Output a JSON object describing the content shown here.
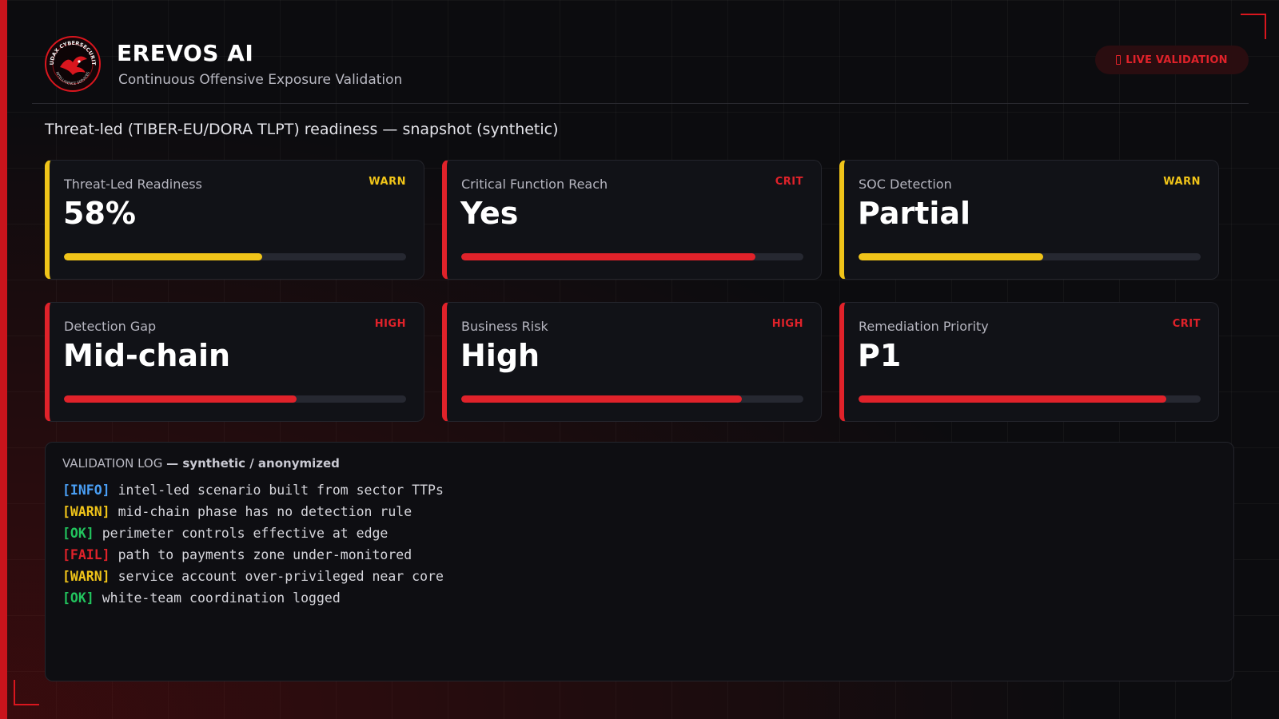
{
  "brand": {
    "title": "EREVOS AI",
    "subtitle": "Continuous Offensive Exposure Validation",
    "logo_ring_text_top": "AUDAX CYBERSECURITY",
    "logo_ring_text_bottom": "INTELLIGENCE SERVICES"
  },
  "badge": {
    "icon": "live-icon",
    "label": "LIVE VALIDATION"
  },
  "snapshot_title": "Threat-led (TIBER-EU/DORA TLPT) readiness — snapshot (synthetic)",
  "colors": {
    "accent": "#e0222a",
    "warn": "#f0c419",
    "info": "#4a9ff5",
    "ok": "#22c55e",
    "background": "#0c0c0f"
  },
  "cards": [
    {
      "label": "Threat-Led Readiness",
      "tag": "WARN",
      "value": "58%",
      "level": 0.58,
      "severity": "warn"
    },
    {
      "label": "Critical Function Reach",
      "tag": "CRIT",
      "value": "Yes",
      "level": 0.86,
      "severity": "crit"
    },
    {
      "label": "SOC Detection",
      "tag": "WARN",
      "value": "Partial",
      "level": 0.54,
      "severity": "warn"
    },
    {
      "label": "Detection Gap",
      "tag": "HIGH",
      "value": "Mid-chain",
      "level": 0.68,
      "severity": "high"
    },
    {
      "label": "Business Risk",
      "tag": "HIGH",
      "value": "High",
      "level": 0.82,
      "severity": "high"
    },
    {
      "label": "Remediation Priority",
      "tag": "CRIT",
      "value": "P1",
      "level": 0.9,
      "severity": "crit"
    }
  ],
  "log": {
    "title": "VALIDATION LOG",
    "subtitle": "— synthetic / anonymized",
    "lines": [
      {
        "level": "INFO",
        "tag": "[INFO]",
        "text": "intel-led scenario built from sector TTPs"
      },
      {
        "level": "WARN",
        "tag": "[WARN]",
        "text": "mid-chain phase has no detection rule"
      },
      {
        "level": "OK",
        "tag": "[OK]",
        "text": "perimeter controls effective at edge"
      },
      {
        "level": "FAIL",
        "tag": "[FAIL]",
        "text": "path to payments zone under-monitored"
      },
      {
        "level": "WARN",
        "tag": "[WARN]",
        "text": "service account over-privileged near core"
      },
      {
        "level": "OK",
        "tag": "[OK]",
        "text": "white-team coordination logged"
      }
    ]
  }
}
